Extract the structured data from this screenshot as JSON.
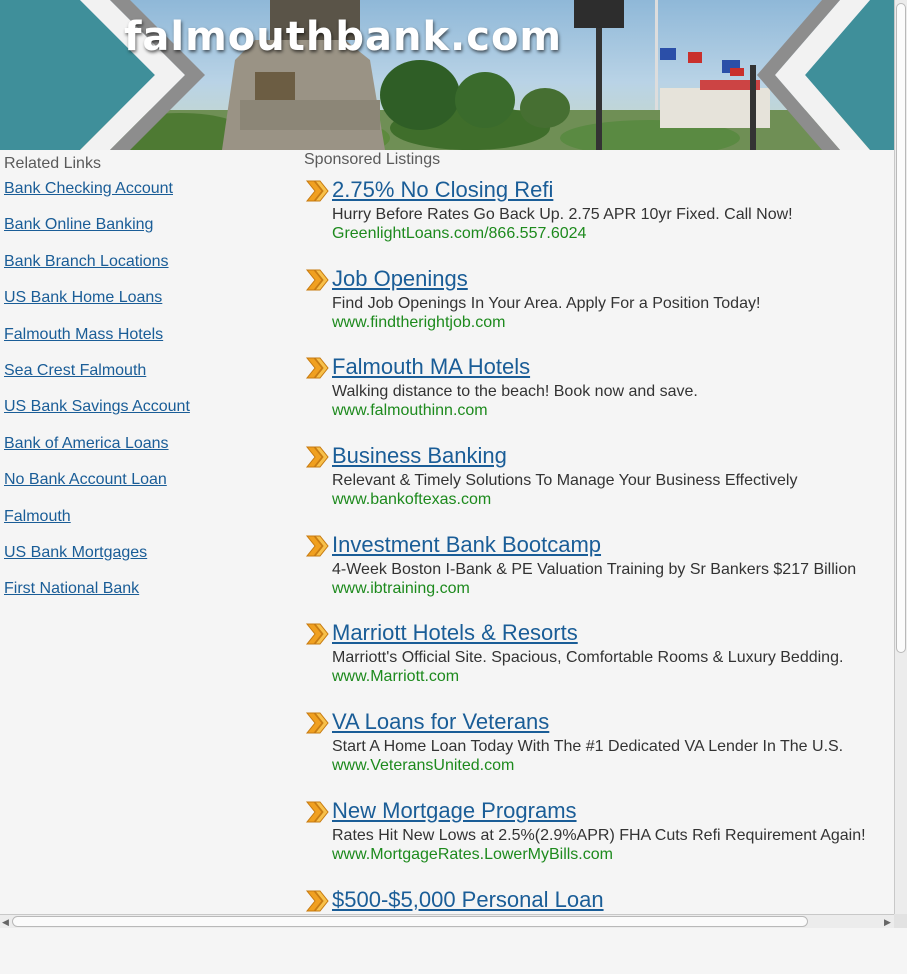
{
  "header": {
    "site_title": "falmouthbank.com"
  },
  "related": {
    "heading": "Related Links",
    "links": [
      "Bank Checking Account",
      "Bank Online Banking",
      "Bank Branch Locations",
      "US Bank Home Loans",
      "Falmouth Mass Hotels",
      "Sea Crest Falmouth",
      "US Bank Savings Account",
      "Bank of America Loans",
      "No Bank Account Loan",
      "Falmouth",
      "US Bank Mortgages",
      "First National Bank"
    ]
  },
  "sponsored": {
    "heading": "Sponsored Listings",
    "listings": [
      {
        "title": "2.75% No Closing Refi",
        "desc": "Hurry Before Rates Go Back Up. 2.75 APR 10yr Fixed. Call Now!",
        "url": "GreenlightLoans.com/866.557.6024"
      },
      {
        "title": "Job Openings",
        "desc": "Find Job Openings In Your Area. Apply For a Position Today!",
        "url": "www.findtherightjob.com"
      },
      {
        "title": "Falmouth MA Hotels",
        "desc": "Walking distance to the beach! Book now and save.",
        "url": "www.falmouthinn.com"
      },
      {
        "title": "Business Banking",
        "desc": "Relevant & Timely Solutions To Manage Your Business Effectively",
        "url": "www.bankoftexas.com"
      },
      {
        "title": "Investment Bank Bootcamp",
        "desc": "4-Week Boston I-Bank & PE Valuation Training by Sr Bankers $217 Billion",
        "url": "www.ibtraining.com"
      },
      {
        "title": "Marriott Hotels & Resorts",
        "desc": "Marriott's Official Site. Spacious, Comfortable Rooms & Luxury Bedding.",
        "url": "www.Marriott.com"
      },
      {
        "title": "VA Loans for Veterans",
        "desc": "Start A Home Loan Today With The #1 Dedicated VA Lender In The U.S.",
        "url": "www.VeteransUnited.com"
      },
      {
        "title": "New Mortgage Programs",
        "desc": "Rates Hit New Lows at 2.5%(2.9%APR) FHA Cuts Refi Requirement Again!",
        "url": "www.MortgageRates.LowerMyBills.com"
      },
      {
        "title": "$500-$5,000 Personal Loan",
        "desc": "",
        "url": ""
      }
    ]
  },
  "colors": {
    "link_blue": "#1a5d97",
    "url_green": "#1d8a1d",
    "header_teal": "#3f8f9a",
    "arrow_orange": "#f0a020"
  },
  "icons": {
    "listing_bullet": "double-chevron-icon",
    "scroll_left": "arrow-left-icon",
    "scroll_right": "arrow-right-icon"
  }
}
